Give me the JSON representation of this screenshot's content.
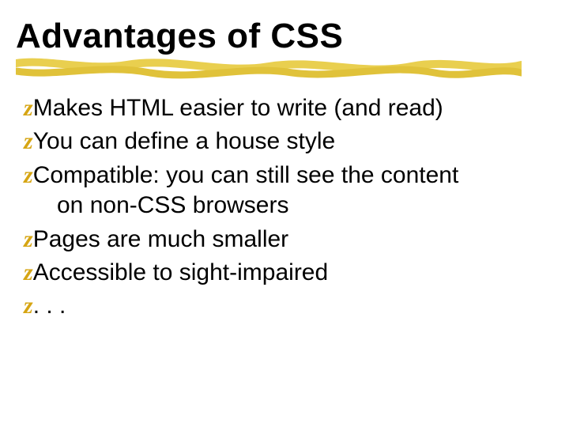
{
  "title": "Advantages of CSS",
  "bullet_marker": "z",
  "bullets": [
    {
      "text": "Makes HTML easier to write (and read)",
      "cont": null
    },
    {
      "text": "You can define a house style",
      "cont": null
    },
    {
      "text": "Compatible: you can still see the content",
      "cont": "on non-CSS browsers"
    },
    {
      "text": "Pages are much smaller",
      "cont": null
    },
    {
      "text": "Accessible to sight-impaired",
      "cont": null
    },
    {
      "text": ". . .",
      "cont": null
    }
  ],
  "colors": {
    "accent": "#e0c23a",
    "bullet_marker": "#d6a513"
  }
}
